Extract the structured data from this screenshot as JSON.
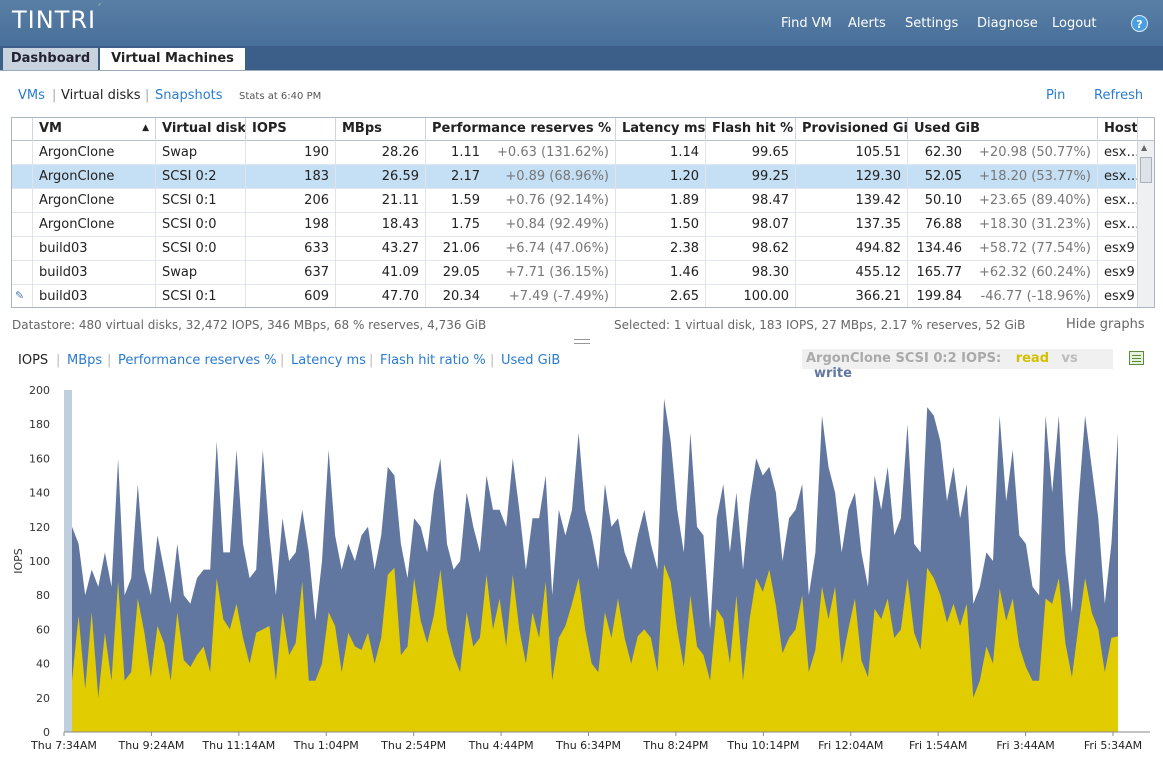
{
  "app": {
    "logo": "TINTRI"
  },
  "nav": {
    "items": [
      "Find VM",
      "Alerts",
      "Settings",
      "Diagnose",
      "Logout"
    ],
    "help": "?"
  },
  "tabs": [
    "Dashboard",
    "Virtual Machines"
  ],
  "subnav": {
    "vms": "VMs",
    "virtual_disks": "Virtual disks",
    "snapshots": "Snapshots",
    "stats": "Stats at 6:40 PM",
    "pin": "Pin",
    "refresh": "Refresh"
  },
  "table": {
    "columns": [
      "VM",
      "Virtual disk",
      "IOPS",
      "MBps",
      "Performance reserves %",
      "Latency ms",
      "Flash hit %",
      "Provisioned GiB",
      "Used GiB",
      "Host"
    ],
    "rows": [
      {
        "vm": "ArgonClone",
        "disk": "Swap",
        "iops": "190",
        "mbps": "28.26",
        "reserve": "1.11",
        "reserve_delta": "+0.63 (131.62%)",
        "latency": "1.14",
        "flash": "99.65",
        "provisioned": "105.51",
        "used": "62.30",
        "used_delta": "+20.98 (50.77%)",
        "host": "esx…"
      },
      {
        "vm": "ArgonClone",
        "disk": "SCSI 0:2",
        "iops": "183",
        "mbps": "26.59",
        "reserve": "2.17",
        "reserve_delta": "+0.89 (68.96%)",
        "latency": "1.20",
        "flash": "99.25",
        "provisioned": "129.30",
        "used": "52.05",
        "used_delta": "+18.20 (53.77%)",
        "host": "esx…"
      },
      {
        "vm": "ArgonClone",
        "disk": "SCSI 0:1",
        "iops": "206",
        "mbps": "21.11",
        "reserve": "1.59",
        "reserve_delta": "+0.76 (92.14%)",
        "latency": "1.89",
        "flash": "98.47",
        "provisioned": "139.42",
        "used": "50.10",
        "used_delta": "+23.65 (89.40%)",
        "host": "esx…"
      },
      {
        "vm": "ArgonClone",
        "disk": "SCSI 0:0",
        "iops": "198",
        "mbps": "18.43",
        "reserve": "1.75",
        "reserve_delta": "+0.84 (92.49%)",
        "latency": "1.50",
        "flash": "98.07",
        "provisioned": "137.35",
        "used": "76.88",
        "used_delta": "+18.30 (31.23%)",
        "host": "esx…"
      },
      {
        "vm": "build03",
        "disk": "SCSI 0:0",
        "iops": "633",
        "mbps": "43.27",
        "reserve": "21.06",
        "reserve_delta": "+6.74 (47.06%)",
        "latency": "2.38",
        "flash": "98.62",
        "provisioned": "494.82",
        "used": "134.46",
        "used_delta": "+58.72 (77.54%)",
        "host": "esx9"
      },
      {
        "vm": "build03",
        "disk": "Swap",
        "iops": "637",
        "mbps": "41.09",
        "reserve": "29.05",
        "reserve_delta": "+7.71 (36.15%)",
        "latency": "1.46",
        "flash": "98.30",
        "provisioned": "455.12",
        "used": "165.77",
        "used_delta": "+62.32 (60.24%)",
        "host": "esx9"
      },
      {
        "vm": "build03",
        "disk": "SCSI 0:1",
        "iops": "609",
        "mbps": "47.70",
        "reserve": "20.34",
        "reserve_delta": "+7.49 (-7.49%)",
        "latency": "2.65",
        "flash": "100.00",
        "provisioned": "366.21",
        "used": "199.84",
        "used_delta": "-46.77 (-18.96%)",
        "host": "esx9"
      }
    ],
    "selected_row": 1
  },
  "summary": {
    "datastore": "Datastore: 480 virtual disks, 32,472 IOPS, 346 MBps, 68 % reserves, 4,736 GiB",
    "selected": "Selected: 1 virtual disk, 183 IOPS, 27 MBps, 2.17 % reserves, 52 GiB",
    "hide_graphs": "Hide graphs"
  },
  "chart_tabs": [
    "IOPS",
    "MBps",
    "Performance reserves %",
    "Latency ms",
    "Flash hit ratio %",
    "Used GiB"
  ],
  "legend": {
    "title": "ArgonClone SCSI 0:2 IOPS:",
    "read": "read",
    "vs": "vs",
    "write": "write"
  },
  "colors": {
    "read": "#e0cc00",
    "write": "#62779f",
    "accent": "#2a7bd1",
    "topbar": "#5a7fa6"
  },
  "chart_data": {
    "type": "area",
    "ylabel": "IOPS",
    "ylim": [
      0,
      200
    ],
    "yticks": [
      0,
      20,
      40,
      60,
      80,
      100,
      120,
      140,
      160,
      180,
      200
    ],
    "xticks": [
      "Thu 7:34AM",
      "Thu 9:24AM",
      "Thu 11:14AM",
      "Thu 1:04PM",
      "Thu 2:54PM",
      "Thu 4:44PM",
      "Thu 6:34PM",
      "Thu 8:24PM",
      "Thu 10:14PM",
      "Fri 12:04AM",
      "Fri 1:54AM",
      "Fri 3:44AM",
      "Fri 5:34AM"
    ],
    "series": [
      {
        "name": "read",
        "values": [
          30,
          68,
          25,
          70,
          20,
          58,
          30,
          88,
          30,
          35,
          78,
          58,
          32,
          62,
          52,
          30,
          70,
          42,
          38,
          45,
          50,
          35,
          90,
          66,
          60,
          75,
          55,
          40,
          58,
          60,
          62,
          30,
          70,
          45,
          52,
          88,
          30,
          30,
          40,
          70,
          62,
          35,
          58,
          50,
          48,
          58,
          40,
          55,
          92,
          96,
          45,
          50,
          90,
          65,
          52,
          68,
          95,
          60,
          45,
          35,
          70,
          50,
          55,
          92,
          60,
          78,
          50,
          92,
          60,
          40,
          70,
          55,
          88,
          30,
          55,
          62,
          75,
          90,
          60,
          40,
          35,
          70,
          55,
          78,
          55,
          40,
          56,
          60,
          55,
          35,
          98,
          88,
          60,
          38,
          80,
          50,
          45,
          30,
          72,
          66,
          40,
          80,
          30,
          66,
          90,
          82,
          95,
          74,
          46,
          55,
          60,
          80,
          35,
          48,
          85,
          66,
          85,
          40,
          60,
          78,
          42,
          32,
          72,
          66,
          78,
          55,
          60,
          90,
          58,
          48,
          96,
          90,
          80,
          64,
          75,
          62,
          75,
          20,
          30,
          50,
          40,
          84,
          65,
          78,
          50,
          38,
          30,
          30,
          78,
          75,
          90,
          52,
          32,
          62,
          90,
          70,
          60,
          35,
          55,
          56
        ]
      },
      {
        "name": "write",
        "values": [
          120,
          110,
          80,
          95,
          85,
          105,
          85,
          160,
          80,
          90,
          145,
          95,
          80,
          115,
          95,
          75,
          110,
          80,
          75,
          90,
          95,
          95,
          170,
          105,
          105,
          165,
          110,
          90,
          95,
          165,
          115,
          80,
          125,
          100,
          105,
          130,
          105,
          65,
          100,
          165,
          115,
          95,
          110,
          100,
          115,
          120,
          95,
          115,
          155,
          150,
          110,
          90,
          125,
          120,
          105,
          140,
          160,
          110,
          95,
          100,
          140,
          120,
          105,
          150,
          130,
          130,
          120,
          160,
          130,
          95,
          125,
          125,
          150,
          80,
          130,
          115,
          130,
          175,
          130,
          115,
          95,
          145,
          120,
          125,
          105,
          95,
          115,
          130,
          110,
          95,
          195,
          170,
          130,
          105,
          175,
          120,
          115,
          60,
          125,
          145,
          105,
          140,
          95,
          135,
          160,
          150,
          155,
          140,
          100,
          125,
          130,
          145,
          80,
          105,
          185,
          155,
          140,
          105,
          130,
          140,
          105,
          85,
          150,
          130,
          155,
          115,
          125,
          180,
          110,
          105,
          190,
          185,
          170,
          135,
          155,
          125,
          145,
          75,
          85,
          105,
          100,
          185,
          135,
          165,
          115,
          110,
          85,
          80,
          185,
          140,
          185,
          105,
          70,
          135,
          185,
          155,
          125,
          75,
          110,
          175
        ]
      }
    ],
    "stacked": true,
    "grid": false
  }
}
